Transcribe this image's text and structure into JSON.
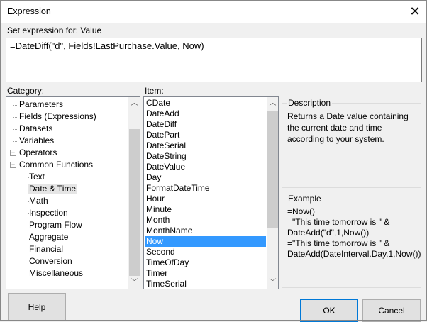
{
  "window": {
    "title": "Expression",
    "close_icon": "close-icon"
  },
  "expression": {
    "label": "Set expression for: Value",
    "value": "=DateDiff(\"d\", Fields!LastPurchase.Value, Now)"
  },
  "category": {
    "label": "Category:",
    "items": [
      {
        "label": "Parameters",
        "level": 0
      },
      {
        "label": "Fields (Expressions)",
        "level": 0
      },
      {
        "label": "Datasets",
        "level": 0
      },
      {
        "label": "Variables",
        "level": 0
      },
      {
        "label": "Operators",
        "level": 0,
        "expander": "plus"
      },
      {
        "label": "Common Functions",
        "level": 0,
        "expander": "minus"
      },
      {
        "label": "Text",
        "level": 1
      },
      {
        "label": "Date & Time",
        "level": 1,
        "selected": true
      },
      {
        "label": "Math",
        "level": 1
      },
      {
        "label": "Inspection",
        "level": 1
      },
      {
        "label": "Program Flow",
        "level": 1
      },
      {
        "label": "Aggregate",
        "level": 1
      },
      {
        "label": "Financial",
        "level": 1
      },
      {
        "label": "Conversion",
        "level": 1
      },
      {
        "label": "Miscellaneous",
        "level": 1
      }
    ]
  },
  "item": {
    "label": "Item:",
    "items": [
      "CDate",
      "DateAdd",
      "DateDiff",
      "DatePart",
      "DateSerial",
      "DateString",
      "DateValue",
      "Day",
      "FormatDateTime",
      "Hour",
      "Minute",
      "Month",
      "MonthName",
      "Now",
      "Second",
      "TimeOfDay",
      "Timer",
      "TimeSerial"
    ],
    "selected": "Now"
  },
  "description": {
    "title": "Description",
    "text": "Returns a Date value containing the current date and time according to your system."
  },
  "example": {
    "title": "Example",
    "lines": [
      "=Now()",
      "=\"This time tomorrow is \" &",
      "DateAdd(\"d\",1,Now())",
      "=\"This time tomorrow is \" &",
      "DateAdd(DateInterval.Day,1,Now())"
    ]
  },
  "buttons": {
    "help": "Help",
    "ok": "OK",
    "cancel": "Cancel"
  },
  "colors": {
    "selection": "#3399ff",
    "background": "#f0f0f0"
  }
}
